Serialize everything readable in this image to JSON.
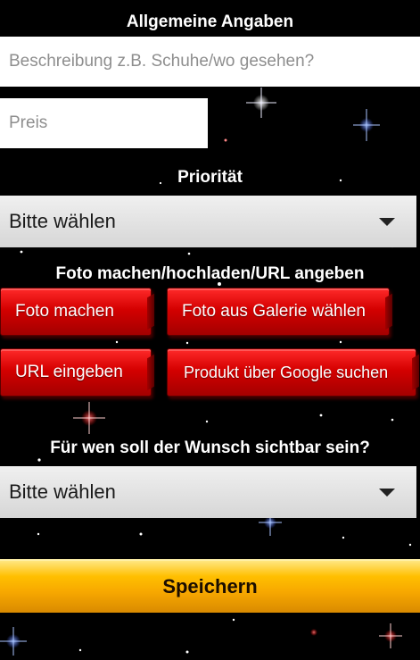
{
  "form": {
    "heading_general": "Allgemeine Angaben",
    "description_placeholder": "Beschreibung z.B. Schuhe/wo gesehen?",
    "price_placeholder": "Preis",
    "heading_priority": "Priorität",
    "priority_select_value": "Bitte wählen",
    "heading_photo": "Foto machen/hochladen/URL angeben",
    "photo_buttons": {
      "take_photo": "Foto machen",
      "gallery": "Foto aus Galerie wählen",
      "url": "URL eingeben",
      "google": "Produkt über Google suchen"
    },
    "heading_visibility": "Für wen soll der Wunsch sichtbar sein?",
    "visibility_select_value": "Bitte wählen",
    "save_label": "Speichern"
  },
  "colors": {
    "background": "#000000",
    "button_red": "#d40000",
    "button_gold": "#ffbf00"
  }
}
